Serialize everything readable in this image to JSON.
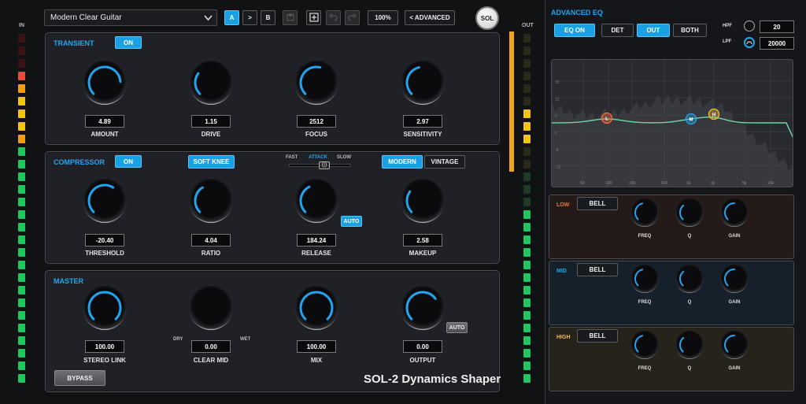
{
  "header": {
    "preset": "Modern Clear Guitar",
    "ab": {
      "a": "A",
      "copy": ">",
      "b": "B"
    },
    "zoom": "100%",
    "advanced": "< ADVANCED",
    "sol": "SOL"
  },
  "meters": {
    "in_label": "IN",
    "out_label": "OUT"
  },
  "transient": {
    "title": "TRANSIENT",
    "on": "ON",
    "knobs": [
      {
        "value": "4.89",
        "label": "AMOUNT"
      },
      {
        "value": "1.15",
        "label": "DRIVE"
      },
      {
        "value": "2512",
        "label": "FOCUS"
      },
      {
        "value": "2.97",
        "label": "SENSITIVITY"
      }
    ]
  },
  "compressor": {
    "title": "COMPRESSOR",
    "on": "ON",
    "soft_knee": "SOFT KNEE",
    "attack": {
      "fast": "FAST",
      "attack": "ATTACK",
      "slow": "SLOW"
    },
    "modern": "MODERN",
    "vintage": "VINTAGE",
    "auto": "AUTO",
    "knobs": [
      {
        "value": "-20.40",
        "label": "THRESHOLD"
      },
      {
        "value": "4.04",
        "label": "RATIO"
      },
      {
        "value": "184.24",
        "label": "RELEASE"
      },
      {
        "value": "2.58",
        "label": "MAKEUP"
      }
    ]
  },
  "master": {
    "title": "MASTER",
    "auto": "AUTO",
    "dry": "DRY",
    "wet": "WET",
    "bypass": "BYPASS",
    "knobs": [
      {
        "value": "100.00",
        "label": "STEREO LINK"
      },
      {
        "value": "0.00",
        "label": "CLEAR MID"
      },
      {
        "value": "100.00",
        "label": "MIX"
      },
      {
        "value": "0.00",
        "label": "OUTPUT"
      }
    ]
  },
  "brand": "SOL-2 Dynamics Shaper",
  "eq": {
    "title": "ADVANCED EQ",
    "eq_on": "EQ ON",
    "det": "DET",
    "out": "OUT",
    "both": "BOTH",
    "hpf_label": "HPF",
    "hpf_value": "20",
    "lpf_label": "LPF",
    "lpf_value": "20000",
    "y_ticks": [
      "18",
      "12",
      "6",
      "0",
      "-6",
      "-12"
    ],
    "x_ticks": [
      "50",
      "100",
      "200",
      "500",
      "1k",
      "2k",
      "5k",
      "10k"
    ],
    "nodes": {
      "low": "L",
      "mid": "M",
      "high": "H"
    },
    "bands": [
      {
        "name": "LOW",
        "type": "BELL",
        "freq": "FREQ",
        "q": "Q",
        "gain": "GAIN",
        "color": "#ff6a3d"
      },
      {
        "name": "MID",
        "type": "BELL",
        "freq": "FREQ",
        "q": "Q",
        "gain": "GAIN",
        "color": "#20a6f0"
      },
      {
        "name": "HIGH",
        "type": "BELL",
        "freq": "FREQ",
        "q": "Q",
        "gain": "GAIN",
        "color": "#f2c230"
      }
    ]
  },
  "colors": {
    "accent": "#20a6f0",
    "meter_green": "#22c55e",
    "meter_yellow": "#f1c40f",
    "meter_orange": "#f39c12",
    "meter_red": "#e74c3c"
  }
}
